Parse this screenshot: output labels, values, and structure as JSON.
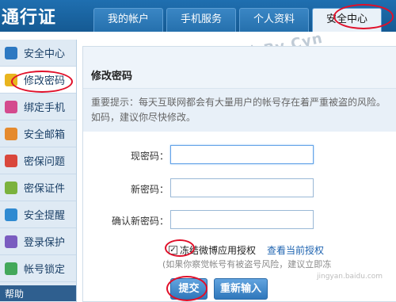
{
  "header": {
    "logo": "通行证",
    "tabs": [
      {
        "label": "我的帐户",
        "active": false
      },
      {
        "label": "手机服务",
        "active": false
      },
      {
        "label": "个人资料",
        "active": false
      },
      {
        "label": "安全中心",
        "active": true
      }
    ]
  },
  "watermark": "百度经验 By Cyn",
  "sidebar": {
    "items": [
      {
        "label": "安全中心",
        "icon": "home-icon",
        "color": "#2d79c2",
        "active": false
      },
      {
        "label": "修改密码",
        "icon": "key-icon",
        "color": "#e9b51f",
        "active": true
      },
      {
        "label": "绑定手机",
        "icon": "phone-icon",
        "color": "#d44a8e",
        "active": false
      },
      {
        "label": "安全邮箱",
        "icon": "mail-icon",
        "color": "#e58a2e",
        "active": false
      },
      {
        "label": "密保问题",
        "icon": "edit-icon",
        "color": "#d9473c",
        "active": false
      },
      {
        "label": "密保证件",
        "icon": "id-card-icon",
        "color": "#7bb23d",
        "active": false
      },
      {
        "label": "安全提醒",
        "icon": "chat-icon",
        "color": "#2f8ad1",
        "active": false
      },
      {
        "label": "登录保护",
        "icon": "monitor-icon",
        "color": "#7a5cc0",
        "active": false
      },
      {
        "label": "帐号锁定",
        "icon": "lock-icon",
        "color": "#43a85a",
        "active": false
      }
    ],
    "footer": "帮助"
  },
  "main": {
    "title": "修改密码",
    "notice": "重要提示：每天互联网都会有大量用户的帐号存在着严重被盗的风险。如码，建议你尽快修改。",
    "fields": [
      {
        "label": "现密码：",
        "value": "",
        "focused": true
      },
      {
        "label": "新密码：",
        "value": "",
        "focused": false
      },
      {
        "label": "确认新密码：",
        "value": "",
        "focused": false
      }
    ],
    "checkbox_label": "冻结微博应用授权",
    "checkbox_checked": true,
    "checkbox_mark": "✓",
    "view_link": "查看当前授权",
    "hint": "(如果你察觉帐号有被盗号风险，建议立即冻",
    "submit_label": "提交",
    "reset_label": "重新输入"
  },
  "watermark_bottom": "jingyan.baidu.com"
}
